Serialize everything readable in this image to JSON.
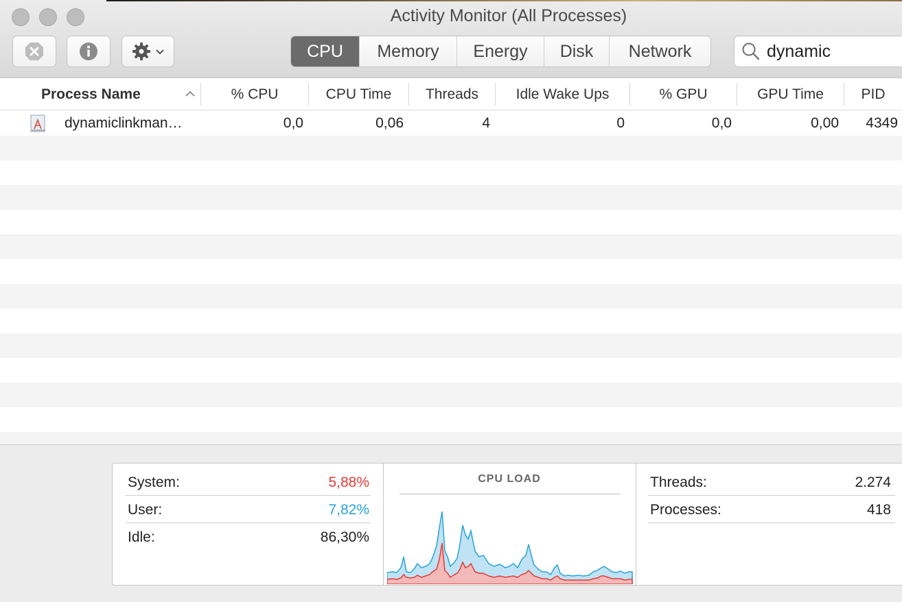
{
  "window": {
    "title": "Activity Monitor (All Processes)"
  },
  "toolbar": {
    "tabs": [
      {
        "label": "CPU",
        "active": true
      },
      {
        "label": "Memory",
        "active": false
      },
      {
        "label": "Energy",
        "active": false
      },
      {
        "label": "Disk",
        "active": false
      },
      {
        "label": "Network",
        "active": false
      }
    ],
    "search_value": "dynamic"
  },
  "table": {
    "columns": [
      "Process Name",
      "% CPU",
      "CPU Time",
      "Threads",
      "Idle Wake Ups",
      "% GPU",
      "GPU Time",
      "PID"
    ],
    "sort_column": "Process Name",
    "sort_direction": "ascending",
    "rows": [
      {
        "name": "dynamiclinkman…",
        "cpu": "0,0",
        "cpu_time": "0,06",
        "threads": "4",
        "idle_wake_ups": "0",
        "gpu": "0,0",
        "gpu_time": "0,00",
        "pid": "4349"
      }
    ]
  },
  "summary": {
    "system_label": "System:",
    "system_value": "5,88%",
    "user_label": "User:",
    "user_value": "7,82%",
    "idle_label": "Idle:",
    "idle_value": "86,30%",
    "cpu_load_title": "CPU LOAD",
    "threads_label": "Threads:",
    "threads_value": "2.274",
    "processes_label": "Processes:",
    "processes_value": "418"
  },
  "colors": {
    "system": "#e53935",
    "user": "#29a3d6",
    "active_tab": "#6b6b6b"
  },
  "icons": [
    "close-process-icon",
    "info-icon",
    "gear-icon",
    "chevron-down-icon",
    "search-icon",
    "sort-ascending-icon",
    "app-icon"
  ]
}
